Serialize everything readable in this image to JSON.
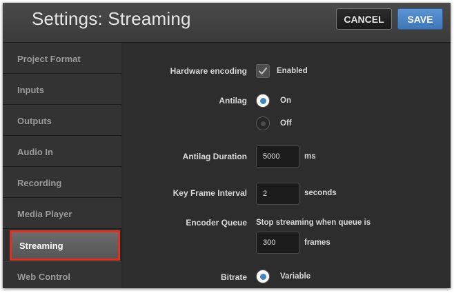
{
  "window": {
    "title": "Settings: Streaming",
    "cancel_label": "CANCEL",
    "save_label": "SAVE"
  },
  "sidebar": {
    "items": [
      {
        "label": "Project Format"
      },
      {
        "label": "Inputs"
      },
      {
        "label": "Outputs"
      },
      {
        "label": "Audio In"
      },
      {
        "label": "Recording"
      },
      {
        "label": "Media Player"
      },
      {
        "label": "Streaming",
        "active": true
      },
      {
        "label": "Web Control"
      }
    ]
  },
  "settings": {
    "hardware_encoding": {
      "label": "Hardware encoding",
      "checked": true,
      "option_label": "Enabled"
    },
    "antilag": {
      "label": "Antilag",
      "options": [
        {
          "label": "On",
          "selected": true
        },
        {
          "label": "Off",
          "selected": false
        }
      ]
    },
    "antilag_duration": {
      "label": "Antilag Duration",
      "value": "5000",
      "unit": "ms"
    },
    "key_frame_interval": {
      "label": "Key Frame Interval",
      "value": "2",
      "unit": "seconds"
    },
    "encoder_queue": {
      "label": "Encoder Queue",
      "description": "Stop streaming when queue is",
      "value": "300",
      "unit": "frames"
    },
    "bitrate": {
      "label": "Bitrate",
      "option_label": "Variable",
      "selected": true
    }
  },
  "colors": {
    "accent_blue": "#3f86c7",
    "highlight_red": "#e0301e",
    "background": "#2d2d2d"
  },
  "icons": {
    "checkmark": "check-icon"
  }
}
